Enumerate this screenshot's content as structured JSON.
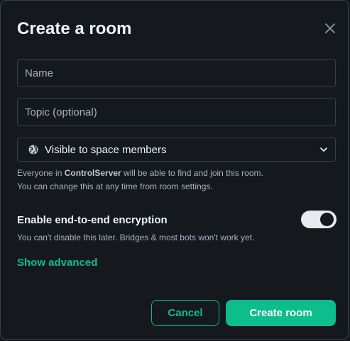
{
  "dialog": {
    "title": "Create a room",
    "close_icon": "close-icon"
  },
  "form": {
    "name_placeholder": "Name",
    "name_value": "",
    "topic_placeholder": "Topic (optional)",
    "topic_value": "",
    "visibility": {
      "icon": "globe-icon",
      "selected": "Visible to space members",
      "chevron_icon": "chevron-down-icon"
    },
    "visibility_help": {
      "prefix": "Everyone in ",
      "space_name": "ControlServer",
      "suffix": " will be able to find and join this room. You can change this at any time from room settings."
    },
    "encryption": {
      "label": "Enable end-to-end encryption",
      "help": "You can't disable this later. Bridges & most bots won't work yet.",
      "enabled": true
    },
    "show_advanced": "Show advanced"
  },
  "actions": {
    "cancel": "Cancel",
    "create": "Create room"
  },
  "colors": {
    "background": "#15191e",
    "accent": "#0dbd8b",
    "text": "#edf3ff",
    "muted": "#a9b2bc"
  }
}
